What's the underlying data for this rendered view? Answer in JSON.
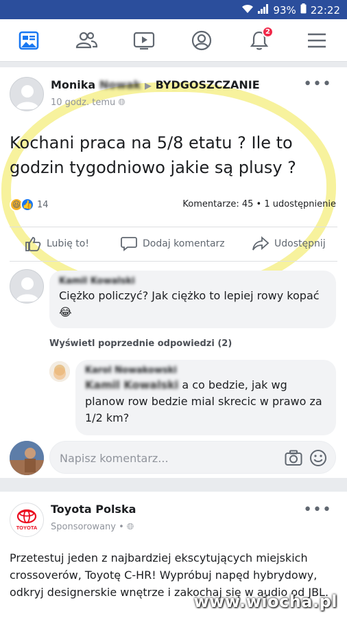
{
  "status_bar": {
    "battery": "93%",
    "time": "22:22"
  },
  "nav": {
    "notifications_badge": "2",
    "items": [
      "news-feed",
      "friends",
      "watch",
      "profile",
      "notifications",
      "menu"
    ]
  },
  "post": {
    "author_first": "Monika",
    "author_last_blurred": "Nowak",
    "group": "BYDGOSZCZANIE",
    "time": "10 godz. temu",
    "text": "Kochani praca na 5/8 etatu ? Ile to godzin tygodniowo jakie są plusy ?",
    "reaction_count": "14",
    "stats": "Komentarze: 45 • 1 udostępnienie",
    "actions": {
      "like": "Lubię to!",
      "comment": "Dodaj komentarz",
      "share": "Udostępnij"
    }
  },
  "comments": [
    {
      "name_blurred": "Kamil Kowalski",
      "text": "Ciężko policzyć?  Jak ciężko to lepiej rowy kopać 😂"
    }
  ],
  "previous_replies_label": "Wyświetl poprzednie odpowiedzi (2)",
  "reply": {
    "name_blurred": "Karol Nowakowski",
    "mention_blurred": "Kamil Kowalski",
    "text": " a co bedzie, jak wg planow row bedzie mial skrecic w prawo za 1/2 km?"
  },
  "composer": {
    "placeholder": "Napisz komentarz..."
  },
  "ad": {
    "title": "Toyota Polska",
    "logo_text": "TOYOTA",
    "meta": "Sponsorowany •",
    "text": "Przetestuj jeden z najbardziej ekscytujących miejskich crossoverów, Toyotę C-HR! Wypróbuj napęd hybrydowy, odkryj designerskie wnętrze i zakochaj się w audio od JBL."
  },
  "watermark": "www.wiocha.pl",
  "colors": {
    "facebook_blue": "#2b4e9c",
    "badge_red": "#f02849",
    "highlight": "#f6f08c"
  }
}
